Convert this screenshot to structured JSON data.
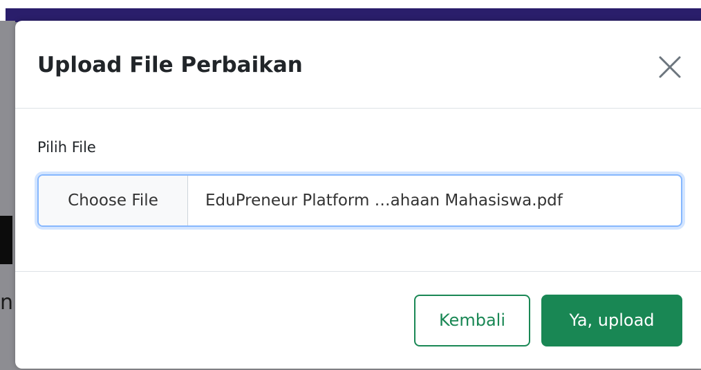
{
  "modal": {
    "title": "Upload File Perbaikan",
    "close_icon": "close-icon"
  },
  "form": {
    "label": "Pilih File",
    "choose_button_label": "Choose File",
    "file_name": "EduPreneur Platform …ahaan Mahasiswa.pdf"
  },
  "footer": {
    "back_label": "Kembali",
    "upload_label": "Ya, upload"
  },
  "colors": {
    "primary_green": "#198754",
    "focus_blue": "#86b7fe",
    "nav_bar": "#2a1e6b"
  }
}
